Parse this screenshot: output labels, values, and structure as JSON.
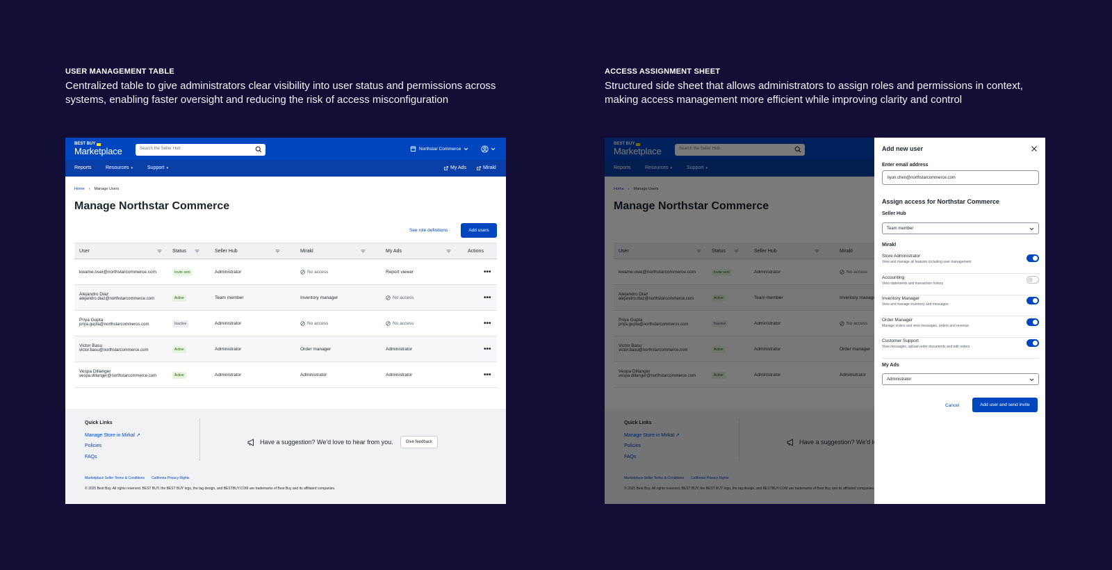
{
  "captions": {
    "left": {
      "title": "USER MANAGEMENT TABLE",
      "text": "Centralized table to give administrators clear visibility into user status and permissions across systems, enabling faster oversight and reducing the risk of access misconfiguration"
    },
    "right": {
      "title": "ACCESS ASSIGNMENT SHEET",
      "text": "Structured side sheet that allows administrators to assign roles and permissions in context, making access management more efficient while improving clarity and control"
    }
  },
  "header": {
    "logo_small": "BEST BUY",
    "logo_main": "Marketplace",
    "search_placeholder": "Search the Seller Hub",
    "store_name": "Northstar Commerce",
    "nav": [
      "Reports",
      "Resources",
      "Support"
    ],
    "nav_right": [
      "My Ads",
      "Mirakl"
    ]
  },
  "breadcrumb": [
    "Home",
    "Manage Users"
  ],
  "page_title": "Manage Northstar Commerce",
  "role_link": "See role definitions",
  "add_button": "Add users",
  "table": {
    "columns": [
      "User",
      "Status",
      "Seller Hub",
      "Mirakl",
      "My Ads",
      "Actions"
    ],
    "rows": [
      {
        "name": "",
        "email": "kwame.osei@northstarcommerce.com",
        "status": "Invite sent",
        "seller_hub": "Administrator",
        "mirakl": "No access",
        "my_ads": "Report viewer"
      },
      {
        "name": "Alejandro Diaz",
        "email": "alejandro.diaz@northstarcommerce.com",
        "status": "Active",
        "seller_hub": "Team member",
        "mirakl": "Inventory manager",
        "my_ads": "No access"
      },
      {
        "name": "Priya Gupta",
        "email": "priya.gupta@northstarcommeros.com",
        "status": "Inactive",
        "seller_hub": "Administrator",
        "mirakl": "No access",
        "my_ads": "No access"
      },
      {
        "name": "Victor Basu",
        "email": "victor.basu@northstarcommerce.com",
        "status": "Active",
        "seller_hub": "Administrator",
        "mirakl": "Order manager",
        "my_ads": "Administrator"
      },
      {
        "name": "Vespa Dillanger",
        "email": "vespa.dillanger@northstarcommerce.com",
        "status": "Active",
        "seller_hub": "Administrator",
        "mirakl": "Administrator",
        "my_ads": "Administrator"
      }
    ]
  },
  "footer": {
    "quick_links_title": "Quick Links",
    "quick_links": [
      "Manage Store in Mirkal",
      "Policies",
      "FAQs"
    ],
    "suggestion": "Have a suggestion? We'd love to hear from you.",
    "feedback_button": "Give feedback",
    "legal_links": [
      "Marketplace Seller Terms & Conditions",
      "California Privacy Rights"
    ],
    "copyright": "© 2025 Best Buy. All rights reserved. BEST BUY, the BEST BUY logo, the tag design, and BESTBUY.COM are trademarks of Best Buy and its affiliated companies."
  },
  "sheet": {
    "title": "Add new user",
    "email_label": "Enter email address",
    "email_value": "liyun.chen@northstarcommerce.com",
    "assign_title": "Assign access for Northstar Commerce",
    "seller_hub_label": "Seller Hub",
    "seller_hub_value": "Team member",
    "mirakl_label": "Mirakl",
    "permissions": [
      {
        "name": "Store Administrator",
        "desc": "View and manage all features including user management",
        "enabled": true
      },
      {
        "name": "Accounting",
        "desc": "View statements and transaction history",
        "enabled": false
      },
      {
        "name": "Inventory Manager",
        "desc": "View and manage inventory and messages",
        "enabled": true
      },
      {
        "name": "Order Manager",
        "desc": "Manage orders and view messages, orders and revenue",
        "enabled": true
      },
      {
        "name": "Customer Support",
        "desc": "View messages, upload order documents and edit orders",
        "enabled": true
      }
    ],
    "my_ads_label": "My Ads",
    "my_ads_value": "Administrator",
    "cancel": "Cancel",
    "submit": "Add user and send invite"
  },
  "colors": {
    "background": "#120e36",
    "brand_blue": "#0046be",
    "nav_blue": "#0a3fa8",
    "logo_tag": "#ffe000"
  }
}
